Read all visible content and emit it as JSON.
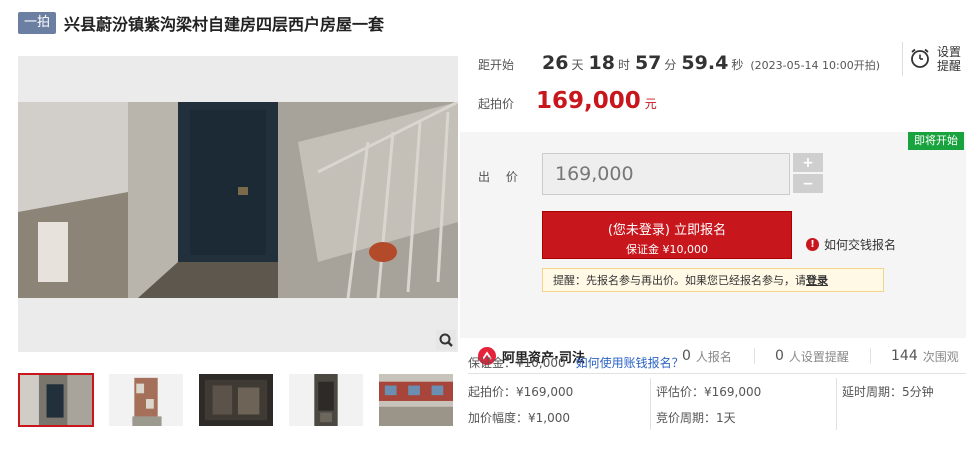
{
  "header": {
    "badge": "一拍",
    "title": "兴县蔚汾镇紫沟梁村自建房四层西户房屋一套"
  },
  "countdown": {
    "label": "距开始",
    "days": "26",
    "days_unit": "天",
    "hours": "18",
    "hours_unit": "时",
    "minutes": "57",
    "minutes_unit": "分",
    "seconds": "59.4",
    "seconds_unit": "秒",
    "start_time": "(2023-05-14 10:00开拍)"
  },
  "remind": {
    "line1": "设置",
    "line2": "提醒",
    "icon": "alarm-clock-icon"
  },
  "start_price": {
    "label": "起拍价",
    "value": "169,000",
    "unit": "元"
  },
  "status_badge": "即将开始",
  "bid": {
    "label": "出 价",
    "input_value": "169,000",
    "plus": "+",
    "minus": "−"
  },
  "register": {
    "line1": "(您未登录) 立即报名",
    "line2": "保证金 ¥10,000"
  },
  "how_pay": "如何交钱报名",
  "tip": {
    "text": "提醒：先报名参与再出价。如果您已经报名参与，请",
    "link": "登录"
  },
  "brand": "阿里资产·司法",
  "stats": {
    "registered_count": "0",
    "registered_label": "人报名",
    "reminder_count": "0",
    "reminder_label": "人设置提醒",
    "views_count": "144",
    "views_label": "次围观"
  },
  "deposit": {
    "text": "保证金：¥10,000",
    "link": "如何使用账钱报名？"
  },
  "details": {
    "start_price": "起拍价：¥169,000",
    "increment": "加价幅度：¥1,000",
    "appraisal": "评估价：¥169,000",
    "bid_cycle": "竞价周期：1天",
    "delay_cycle": "延时周期：5分钟"
  },
  "colors": {
    "accent": "#c8161d",
    "badge": "#6b7fa3",
    "green": "#19a33f",
    "link": "#2b63c7"
  }
}
